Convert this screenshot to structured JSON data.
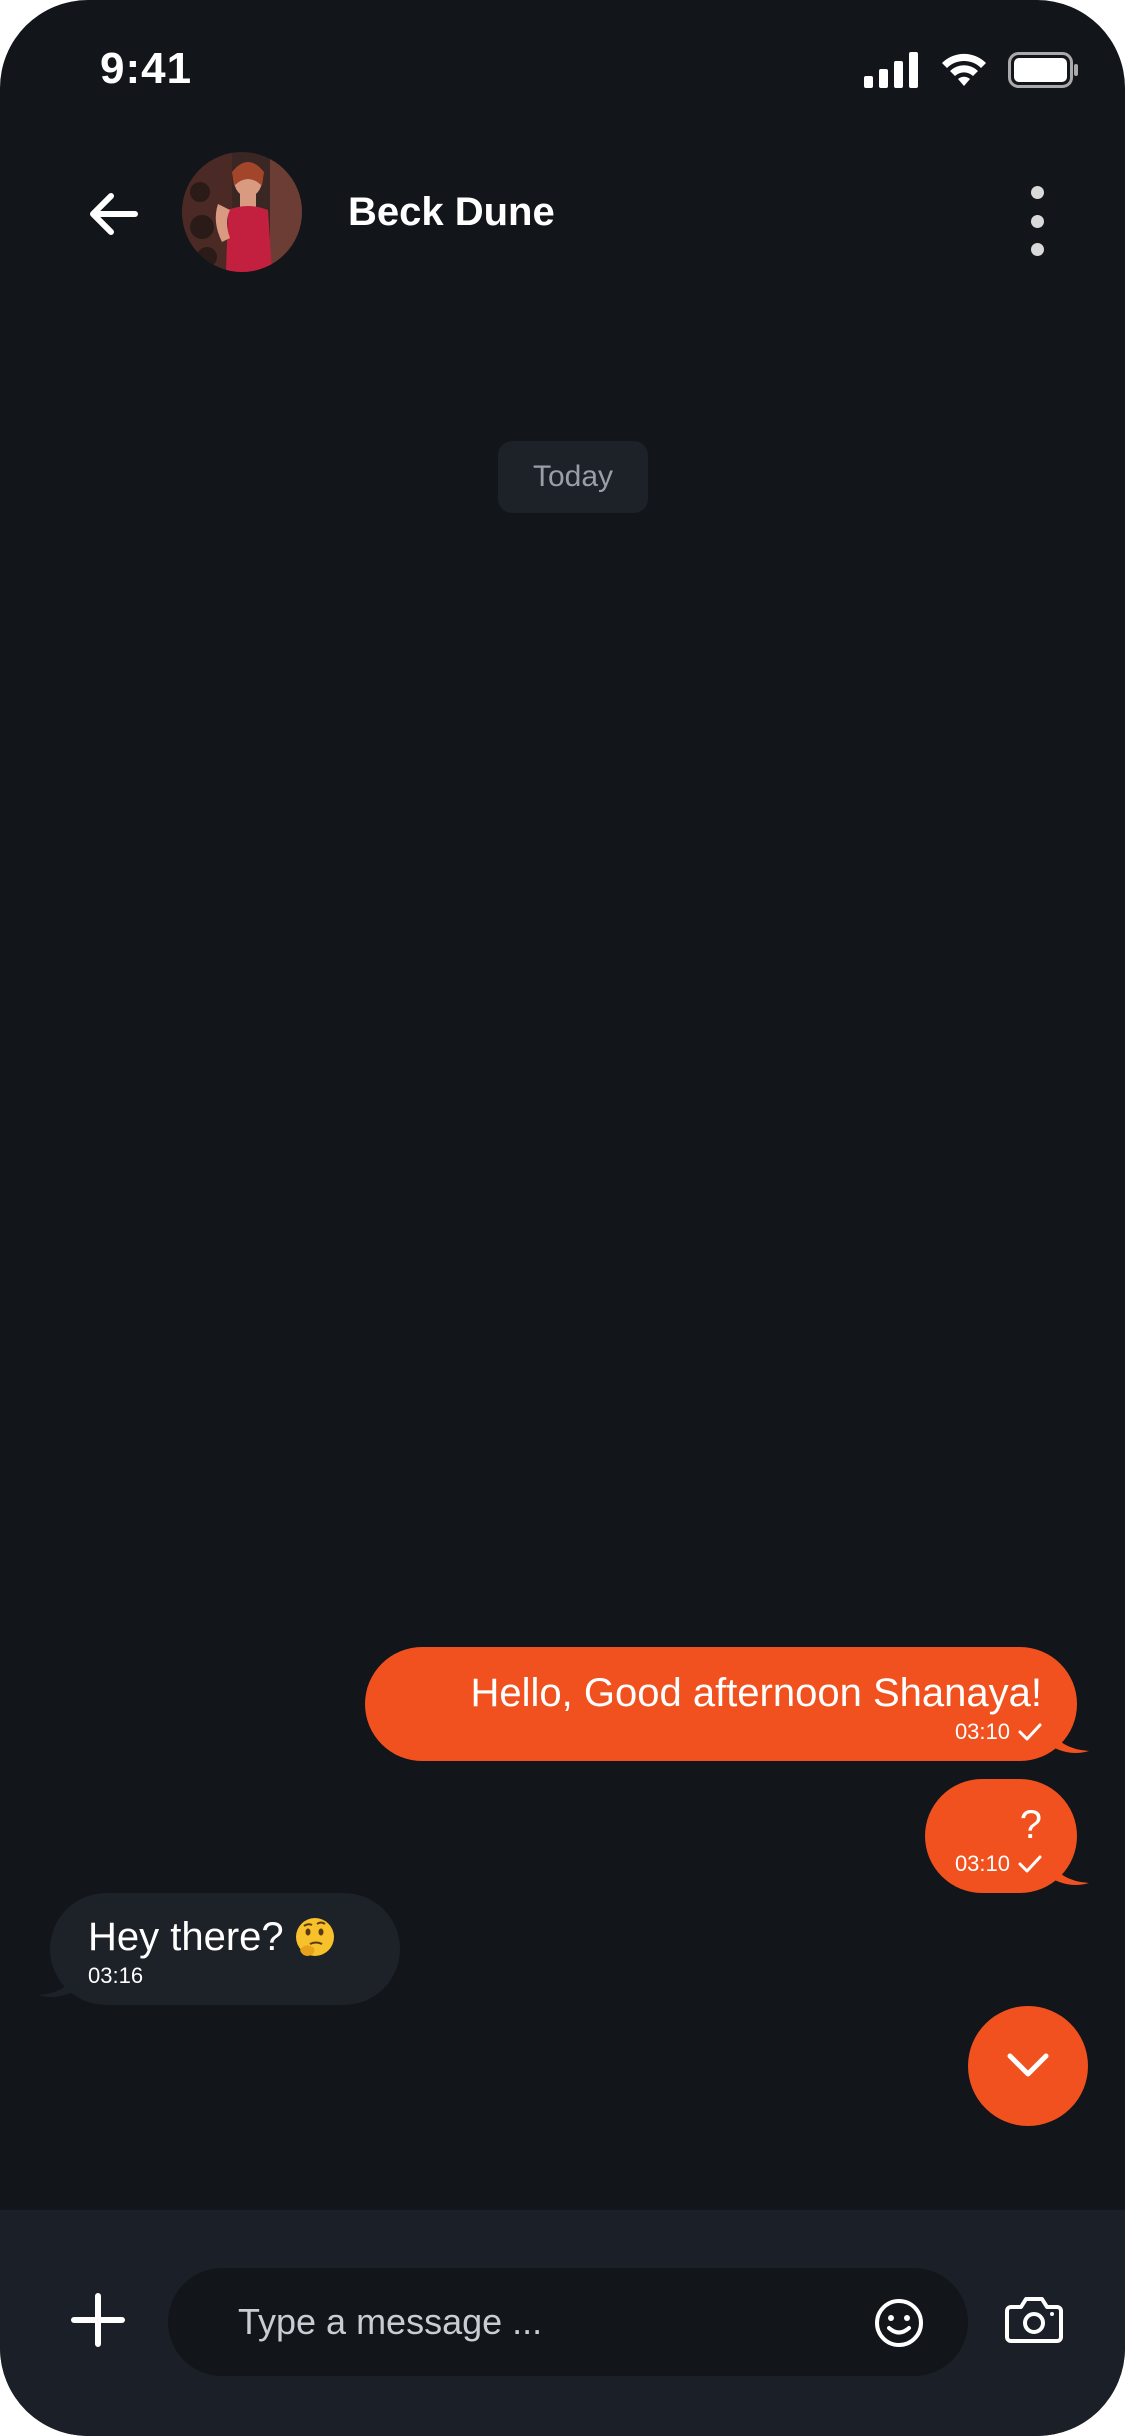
{
  "status_bar": {
    "time": "9:41"
  },
  "header": {
    "contact_name": "Beck Dune"
  },
  "date_divider": "Today",
  "messages": [
    {
      "direction": "outgoing",
      "text": "Hello, Good afternoon Shanaya!",
      "time": "03:10",
      "read": true
    },
    {
      "direction": "outgoing",
      "text": "?",
      "time": "03:10",
      "read": true
    },
    {
      "direction": "incoming",
      "text": "Hey there?",
      "emoji": "thinking-face",
      "time": "03:16"
    }
  ],
  "composer": {
    "placeholder": "Type a message ..."
  },
  "colors": {
    "background": "#12151a",
    "accent": "#f0511e",
    "incoming_bubble": "#1d2128",
    "composer_bar": "#1b1f27"
  },
  "icons": [
    "back-arrow-icon",
    "more-vertical-icon",
    "check-icon",
    "chevron-down-icon",
    "plus-icon",
    "smiley-icon",
    "camera-icon",
    "signal-icon",
    "wifi-icon",
    "battery-icon"
  ]
}
